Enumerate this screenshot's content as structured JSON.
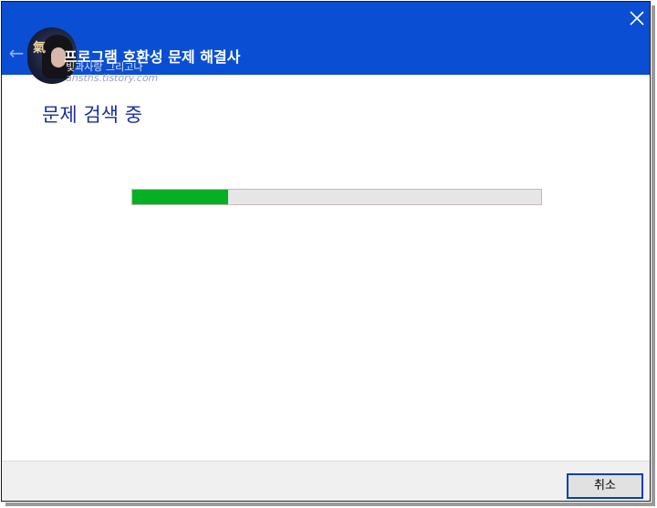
{
  "window": {
    "title": "프로그램 호환성 문제 해결사",
    "heading": "문제 검색 중"
  },
  "watermark": {
    "name": "빛과사랑 그리고나",
    "url": "ansths.tistory.com",
    "logo_text": "氣"
  },
  "icons": {
    "back": "back-arrow-icon",
    "close": "close-icon"
  },
  "progress": {
    "fraction": 0.235
  },
  "footer": {
    "cancel_label": "취소"
  },
  "colors": {
    "titlebar": "#0a4fd3",
    "heading": "#1a2e9a",
    "progress_fill": "#06b025",
    "progress_track": "#e6e6e6",
    "button_border": "#0a3fb0"
  }
}
